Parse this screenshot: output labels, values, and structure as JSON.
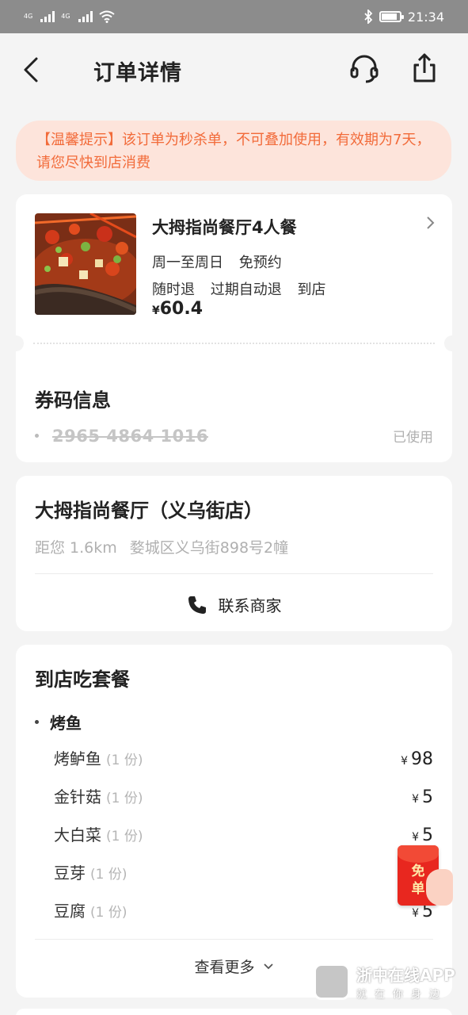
{
  "status_bar": {
    "network_1": "4G",
    "network_2": "4G",
    "time": "21:34",
    "battery_level": 0.85
  },
  "nav": {
    "title": "订单详情",
    "icons": [
      "back-icon",
      "headset-icon",
      "share-icon"
    ]
  },
  "tip": {
    "text": "【温馨提示】该订单为秒杀单，不可叠加使用，有效期为7天，请您尽快到店消费"
  },
  "product": {
    "name": "大拇指尚餐厅4人餐",
    "availability": [
      "周一至周日",
      "免预约"
    ],
    "refund_tags": [
      "随时退",
      "过期自动退",
      "到店"
    ],
    "price_symbol": "¥",
    "price": "60.4"
  },
  "coupon": {
    "title": "券码信息",
    "code": "2965 4864 1016",
    "status": "已使用"
  },
  "store": {
    "name": "大拇指尚餐厅（义乌街店）",
    "distance": "距您 1.6km",
    "address": "婺城区义乌街898号2幢",
    "contact_label": "联系商家"
  },
  "package": {
    "title": "到店吃套餐",
    "category": "烤鱼",
    "currency": "¥",
    "items": [
      {
        "name": "烤鲈鱼",
        "qty": "(1 份)",
        "price": "98"
      },
      {
        "name": "金针菇",
        "qty": "(1 份)",
        "price": "5"
      },
      {
        "name": "大白菜",
        "qty": "(1 份)",
        "price": "5"
      },
      {
        "name": "豆芽",
        "qty": "(1 份)",
        "price": ""
      },
      {
        "name": "豆腐",
        "qty": "(1 份)",
        "price": "5"
      }
    ],
    "more_label": "查看更多"
  },
  "red_packet": {
    "text": "免单"
  },
  "watermark": {
    "title": "浙中在线APP",
    "subtitle": "就在你身边"
  },
  "colors": {
    "accent": "#f26b3a",
    "tip_bg": "#fde4db",
    "red_packet": "#e8271f"
  }
}
